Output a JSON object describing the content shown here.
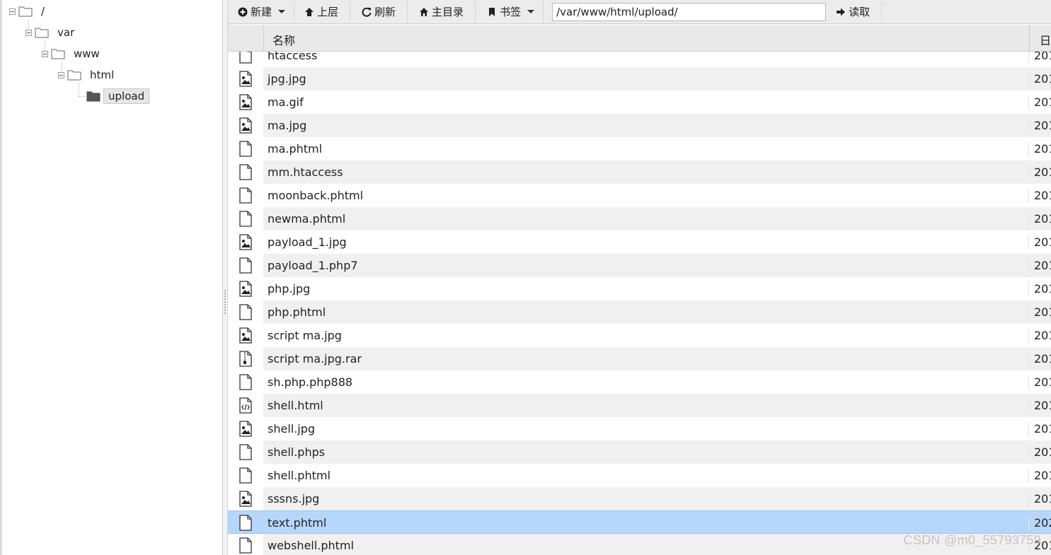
{
  "tree": {
    "nodes": [
      {
        "label": "/",
        "depth": 0
      },
      {
        "label": "var",
        "depth": 1
      },
      {
        "label": "www",
        "depth": 2
      },
      {
        "label": "html",
        "depth": 3
      },
      {
        "label": "upload",
        "depth": 4,
        "selected": true
      }
    ]
  },
  "toolbar": {
    "new_label": "新建",
    "up_label": "上层",
    "refresh_label": "刷新",
    "home_label": "主目录",
    "bookmark_label": "书签",
    "path_value": "/var/www/html/upload/",
    "read_label": "读取"
  },
  "table": {
    "col_name": "名称",
    "col_date": "日",
    "rows": [
      {
        "name": "htaccess",
        "icon": "file-icon",
        "date": "201"
      },
      {
        "name": "jpg.jpg",
        "icon": "image-file-icon",
        "date": "201"
      },
      {
        "name": "ma.gif",
        "icon": "image-file-icon",
        "date": "201"
      },
      {
        "name": "ma.jpg",
        "icon": "image-file-icon",
        "date": "201"
      },
      {
        "name": "ma.phtml",
        "icon": "file-icon",
        "date": "201"
      },
      {
        "name": "mm.htaccess",
        "icon": "file-icon",
        "date": "201"
      },
      {
        "name": "moonback.phtml",
        "icon": "file-icon",
        "date": "201"
      },
      {
        "name": "newma.phtml",
        "icon": "file-icon",
        "date": "201"
      },
      {
        "name": "payload_1.jpg",
        "icon": "image-file-icon",
        "date": "201"
      },
      {
        "name": "payload_1.php7",
        "icon": "file-icon",
        "date": "201"
      },
      {
        "name": "php.jpg",
        "icon": "image-file-icon",
        "date": "201"
      },
      {
        "name": "php.phtml",
        "icon": "file-icon",
        "date": "201"
      },
      {
        "name": "script ma.jpg",
        "icon": "image-file-icon",
        "date": "201"
      },
      {
        "name": "script ma.jpg.rar",
        "icon": "archive-file-icon",
        "date": "201"
      },
      {
        "name": "sh.php.php888",
        "icon": "file-icon",
        "date": "201"
      },
      {
        "name": "shell.html",
        "icon": "code-file-icon",
        "date": "201"
      },
      {
        "name": "shell.jpg",
        "icon": "image-file-icon",
        "date": "201"
      },
      {
        "name": "shell.phps",
        "icon": "file-icon",
        "date": "201"
      },
      {
        "name": "shell.phtml",
        "icon": "file-icon",
        "date": "201"
      },
      {
        "name": "sssns.jpg",
        "icon": "image-file-icon",
        "date": "201"
      },
      {
        "name": "text.phtml",
        "icon": "file-icon",
        "date": "202",
        "selected": true
      },
      {
        "name": "webshell.phtml",
        "icon": "file-icon",
        "date": "201"
      }
    ]
  },
  "watermark": "CSDN @m0_55793759",
  "colors": {
    "selected_row": "#b7d6fb",
    "stripe": "#f0f0f0",
    "toolbar_bg": "#ececec"
  }
}
